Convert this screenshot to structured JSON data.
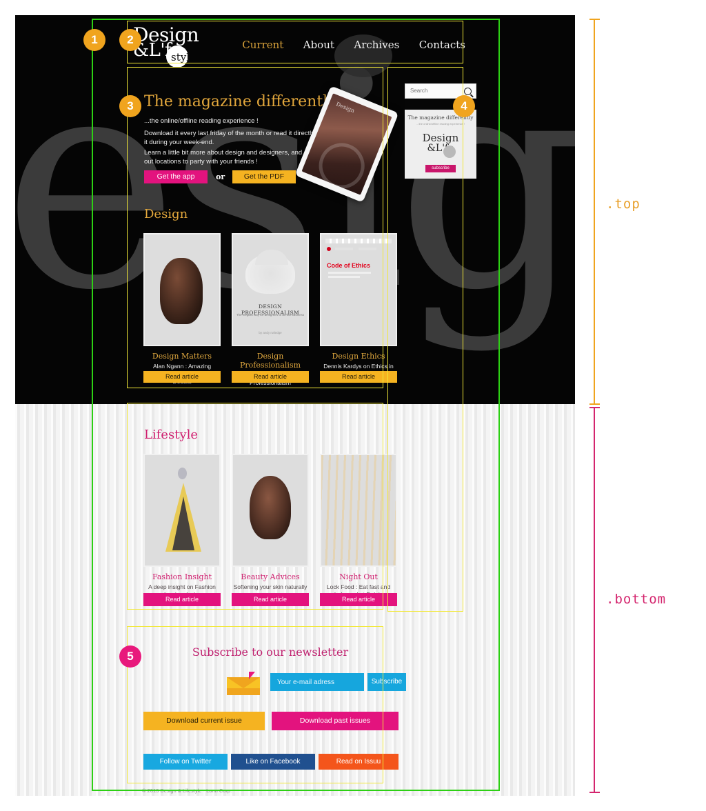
{
  "site": {
    "logo": {
      "line1": "Design",
      "line2": "&L'fe",
      "mark": "styl"
    },
    "nav": [
      {
        "label": "Current",
        "active": true
      },
      {
        "label": "About",
        "active": false
      },
      {
        "label": "Archives",
        "active": false
      },
      {
        "label": "Contacts",
        "active": false
      }
    ],
    "hero": {
      "title": "The magazine differently !",
      "p1": "...the online/offline reading experience !",
      "p2": "Download it every last friday of the month or read it directly here, and enjoy it during your week-end.",
      "p3": "Learn a little bit more about design and designers, and discover some right out locations to party with your friends !",
      "btn_app": "Get the app",
      "or": "or",
      "btn_pdf": "Get the PDF",
      "tablet_caption": "Design\n&L'fe"
    },
    "sidebar": {
      "search_placeholder": "Search",
      "search_value": "",
      "search_icon": "search-icon",
      "promo_title": "The magazine differently",
      "promo_sub": "...the online/offline reading experience !",
      "promo_logo1": "Design",
      "promo_logo2": "&L'fe",
      "promo_button": "subscribe"
    },
    "design": {
      "title": "Design",
      "cards": [
        {
          "title": "Design Matters",
          "desc": "Alan Ngann : Amazing photographer based in Douala",
          "button": "Read article",
          "thumb": "portrait-photo"
        },
        {
          "title": "Design Professionalism",
          "desc": "Andy Rutledge on Design Professionalism",
          "button": "Read article",
          "thumb": "book-cover",
          "thumb_title": "DESIGN PROFESSIONALISM",
          "thumb_sub": "The elegant way for designers to do our business",
          "thumb_foot": "by andy rutledge"
        },
        {
          "title": "Design Ethics",
          "desc": "Dennis Kardys on Ethics in the Design profession",
          "button": "Read article",
          "thumb": "web-page",
          "thumb_title": "Code of Ethics"
        }
      ]
    },
    "lifestyle": {
      "title": "Lifestyle",
      "cards": [
        {
          "title": "Fashion Insight",
          "desc": "A deep insight on Fashion drawing design",
          "button": "Read article",
          "thumb": "fashion-sketch"
        },
        {
          "title": "Beauty Advices",
          "desc": "Softening your skin naturally",
          "button": "Read article",
          "thumb": "beauty-portrait"
        },
        {
          "title": "Night Out",
          "desc": "Lock Food : Eat fast and balanced at Delois",
          "button": "Read article",
          "thumb": "night-club"
        }
      ]
    },
    "newsletter": {
      "title": "Subscribe to our newsletter",
      "email_placeholder": "Your e-mail adress",
      "email_value": "",
      "subscribe": "Subscribe",
      "download_current": "Download current issue",
      "download_past": "Download past issues",
      "twitter": "Follow on Twitter",
      "facebook": "Like on Facebook",
      "issuu": "Read on Issuu",
      "copyright": "© 2013 Design & Lifestyle - Lonn Corp."
    }
  },
  "annotations": {
    "badges": [
      {
        "n": "1",
        "color": "#f0a41e"
      },
      {
        "n": "2",
        "color": "#f0a41e"
      },
      {
        "n": "3",
        "color": "#f0a41e"
      },
      {
        "n": "4",
        "color": "#f0a41e"
      },
      {
        "n": "5",
        "color": "#e8197c"
      }
    ],
    "brace_top": ".top",
    "brace_bottom": ".bottom",
    "colors": {
      "green_guide": "#2dd014",
      "yellow_guide": "#f2e838",
      "top_brace": "#f0a41e",
      "bottom_brace": "#d4256e"
    }
  }
}
